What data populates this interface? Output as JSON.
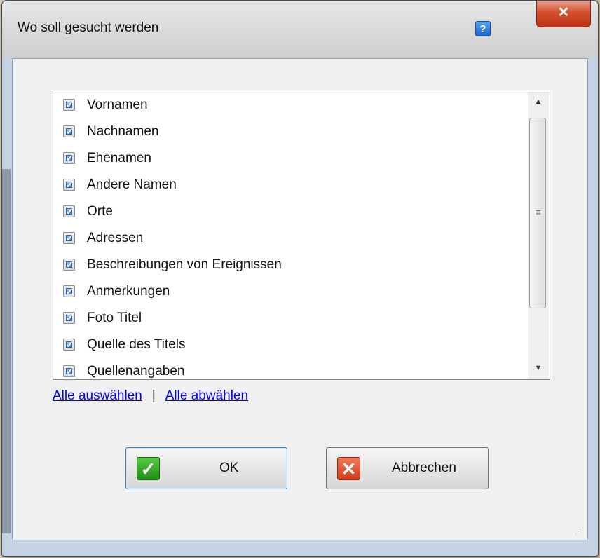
{
  "window": {
    "title": "Wo soll gesucht werden",
    "help_label": "?",
    "close_label": "✕"
  },
  "list": {
    "items": [
      {
        "label": "Vornamen",
        "checked": true
      },
      {
        "label": "Nachnamen",
        "checked": true
      },
      {
        "label": "Ehenamen",
        "checked": true
      },
      {
        "label": "Andere Namen",
        "checked": true
      },
      {
        "label": "Orte",
        "checked": true
      },
      {
        "label": "Adressen",
        "checked": true
      },
      {
        "label": "Beschreibungen von Ereignissen",
        "checked": true
      },
      {
        "label": "Anmerkungen",
        "checked": true
      },
      {
        "label": "Foto Titel",
        "checked": true
      },
      {
        "label": "Quelle des Titels",
        "checked": true
      },
      {
        "label": "Quellenangaben",
        "checked": true
      }
    ]
  },
  "links": {
    "select_all": "Alle auswählen",
    "separator": "|",
    "deselect_all": "Alle abwählen"
  },
  "buttons": {
    "ok_label": "OK",
    "ok_icon": "checkmark-icon",
    "cancel_label": "Abbrechen",
    "cancel_icon": "x-icon"
  },
  "colors": {
    "accent_link": "#0000ee",
    "close_button": "#d4502f",
    "ok_icon": "#2f9e24",
    "cancel_icon": "#d33b17"
  }
}
